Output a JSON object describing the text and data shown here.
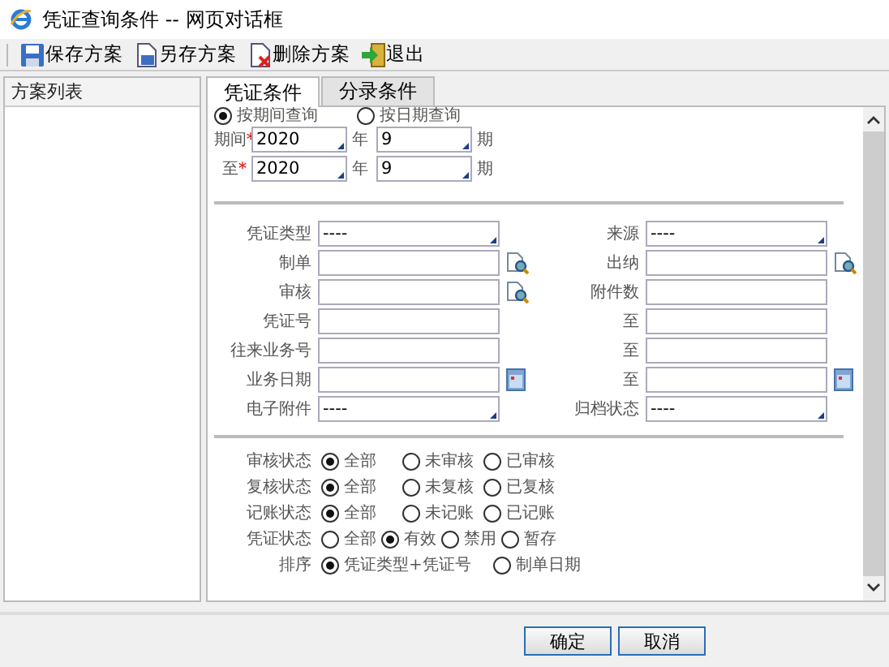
{
  "window": {
    "title": "凭证查询条件 -- 网页对话框"
  },
  "toolbar": [
    {
      "label": "保存方案"
    },
    {
      "label": "另存方案"
    },
    {
      "label": "删除方案"
    },
    {
      "label": "退出"
    }
  ],
  "scheme_panel": {
    "header": "方案列表"
  },
  "tabs": [
    {
      "label": "凭证条件",
      "selected": true
    },
    {
      "label": "分录条件",
      "selected": false
    }
  ],
  "query_mode": [
    {
      "label": "按期间查询",
      "selected": true
    },
    {
      "label": "按日期查询",
      "selected": false
    }
  ],
  "period_rows": [
    {
      "label": "期间",
      "mark": "*",
      "year": "2020",
      "year_unit": "年",
      "period": "9",
      "period_unit": "期"
    },
    {
      "label": "至",
      "mark": "*",
      "year": "2020",
      "year_unit": "年",
      "period": "9",
      "period_unit": "期"
    }
  ],
  "field_rows": [
    [
      {
        "label": "凭证类型",
        "kind": "select",
        "value": "----"
      },
      {
        "label": "来源",
        "kind": "select",
        "value": "----"
      }
    ],
    [
      {
        "label": "制单",
        "kind": "lookup"
      },
      {
        "label": "出纳",
        "kind": "lookup"
      }
    ],
    [
      {
        "label": "审核",
        "kind": "lookup"
      },
      {
        "label": "附件数",
        "kind": "text"
      }
    ],
    [
      {
        "label": "凭证号",
        "kind": "text"
      },
      {
        "label": "至",
        "kind": "text"
      }
    ],
    [
      {
        "label": "往来业务号",
        "kind": "text"
      },
      {
        "label": "至",
        "kind": "text"
      }
    ],
    [
      {
        "label": "业务日期",
        "kind": "date"
      },
      {
        "label": "至",
        "kind": "date"
      }
    ],
    [
      {
        "label": "电子附件",
        "kind": "select",
        "value": "----"
      },
      {
        "label": "归档状态",
        "kind": "select",
        "value": "----"
      }
    ]
  ],
  "status_groups": [
    {
      "label": "审核状态",
      "options": [
        {
          "label": "全部",
          "selected": true
        },
        {
          "label": "未审核",
          "selected": false
        },
        {
          "label": "已审核",
          "selected": false
        }
      ]
    },
    {
      "label": "复核状态",
      "options": [
        {
          "label": "全部",
          "selected": true
        },
        {
          "label": "未复核",
          "selected": false
        },
        {
          "label": "已复核",
          "selected": false
        }
      ]
    },
    {
      "label": "记账状态",
      "options": [
        {
          "label": "全部",
          "selected": true
        },
        {
          "label": "未记账",
          "selected": false
        },
        {
          "label": "已记账",
          "selected": false
        }
      ]
    },
    {
      "label": "凭证状态",
      "options": [
        {
          "label": "全部",
          "selected": false
        },
        {
          "label": "有效",
          "selected": true
        },
        {
          "label": "禁用",
          "selected": false
        },
        {
          "label": "暂存",
          "selected": false
        }
      ]
    },
    {
      "label": "排序",
      "options": [
        {
          "label": "凭证类型+凭证号",
          "selected": true
        },
        {
          "label": "制单日期",
          "selected": false
        }
      ]
    }
  ],
  "buttons": [
    {
      "label": "确定"
    },
    {
      "label": "取消"
    }
  ]
}
